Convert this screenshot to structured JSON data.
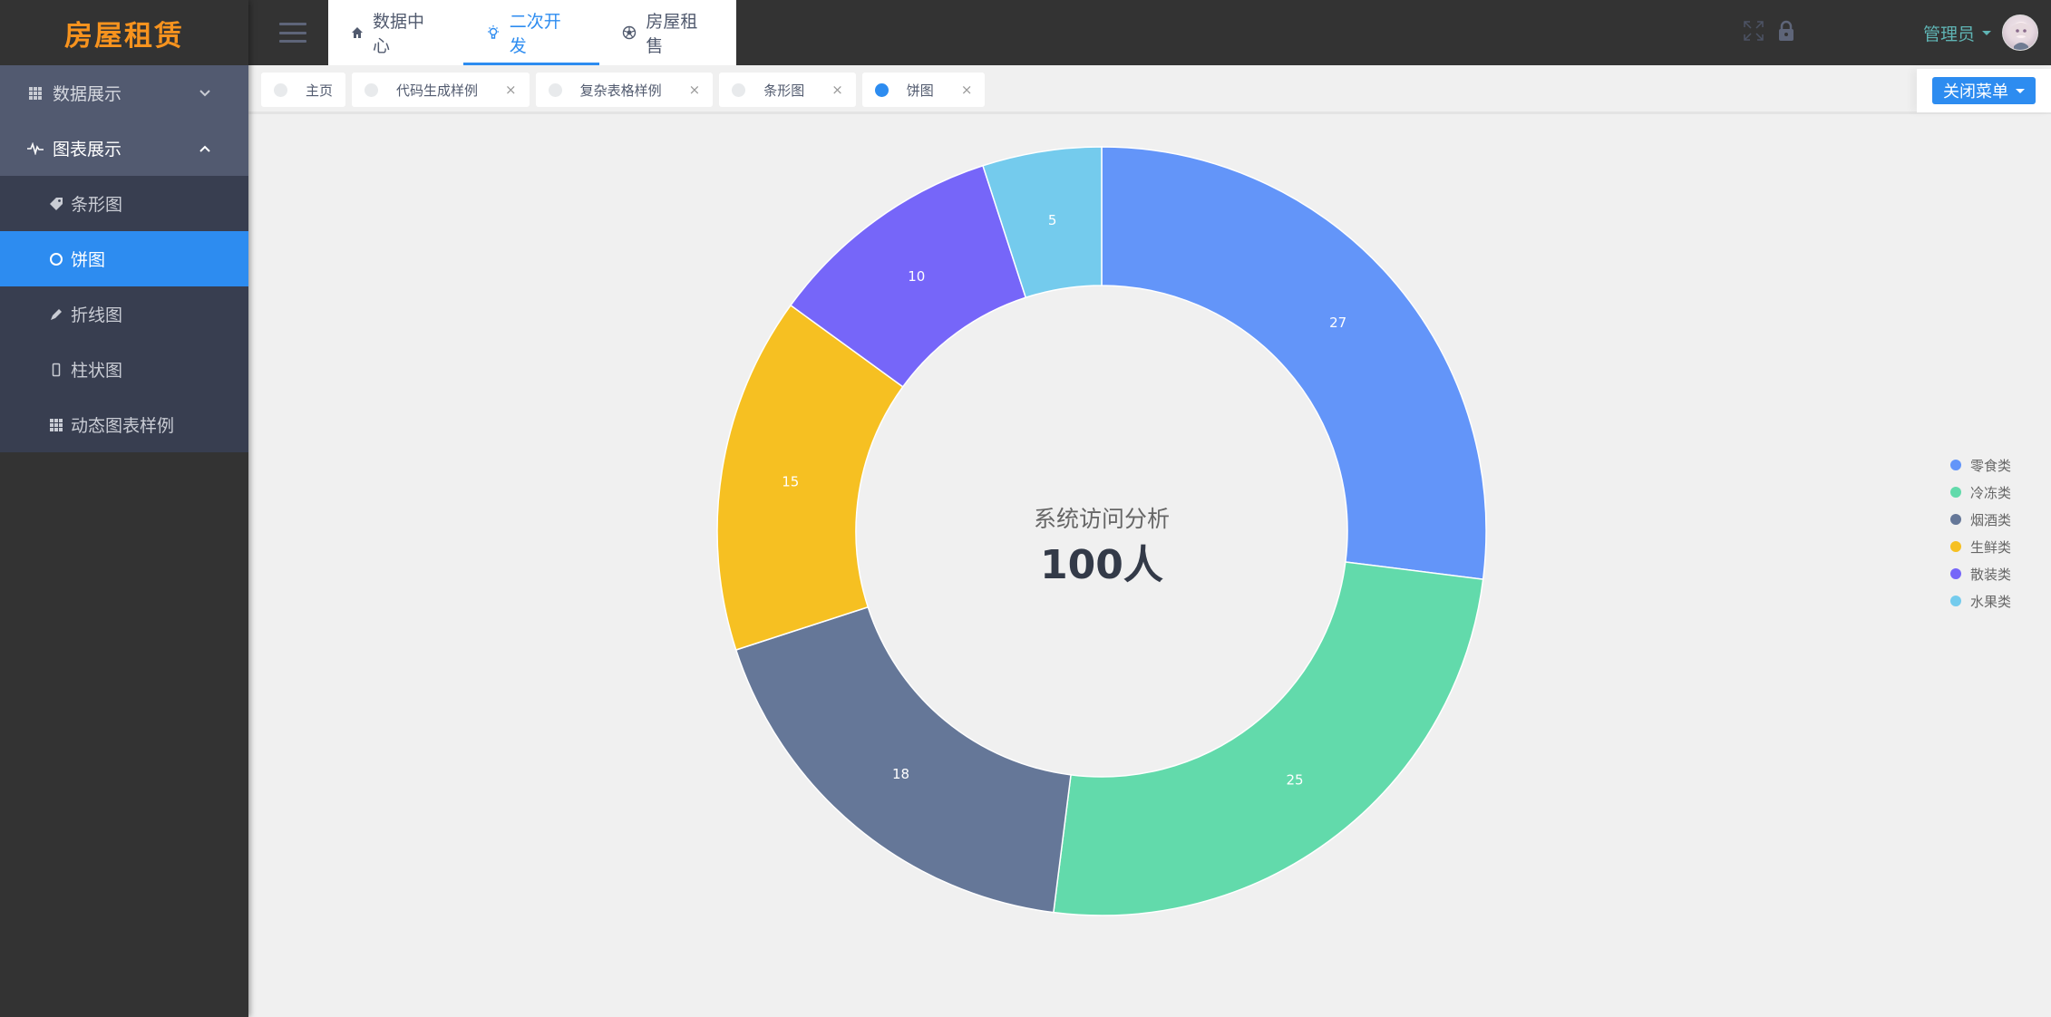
{
  "app": {
    "logo": "房屋租赁"
  },
  "sidebar": {
    "groups": [
      {
        "label": "数据展示",
        "icon": "grid-icon",
        "expanded": false
      },
      {
        "label": "图表展示",
        "icon": "pulse-icon",
        "expanded": true,
        "items": [
          {
            "label": "条形图",
            "icon": "tag-icon"
          },
          {
            "label": "饼图",
            "icon": "circle-icon",
            "active": true
          },
          {
            "label": "折线图",
            "icon": "pen-icon"
          },
          {
            "label": "柱状图",
            "icon": "phone-icon"
          },
          {
            "label": "动态图表样例",
            "icon": "grid-icon"
          }
        ]
      }
    ]
  },
  "header": {
    "nav": [
      {
        "label": "数据中心",
        "icon": "home-icon"
      },
      {
        "label": "二次开发",
        "icon": "bulb-icon",
        "active": true
      },
      {
        "label": "房屋租售",
        "icon": "aperture-icon"
      }
    ],
    "user": "管理员"
  },
  "tabs": [
    {
      "label": "主页",
      "closable": false
    },
    {
      "label": "代码生成样例",
      "closable": true
    },
    {
      "label": "复杂表格样例",
      "closable": true
    },
    {
      "label": "条形图",
      "closable": true
    },
    {
      "label": "饼图",
      "closable": true,
      "active": true
    }
  ],
  "close_glyph": "×",
  "close_menu_label": "关闭菜单",
  "colors": {
    "accent": "#2d8cf0",
    "logo": "#f7931e"
  },
  "chart_data": {
    "type": "pie",
    "variant": "donut",
    "title": "系统访问分析",
    "center_value": "100人",
    "categories": [
      "零食类",
      "冷冻类",
      "烟酒类",
      "生鲜类",
      "散装类",
      "水果类"
    ],
    "values": [
      27,
      25,
      18,
      15,
      10,
      5
    ],
    "colors": [
      "#6395f9",
      "#62daab",
      "#657798",
      "#f6c022",
      "#7666f9",
      "#74cbed"
    ],
    "legend_position": "right",
    "data_labels": true
  }
}
